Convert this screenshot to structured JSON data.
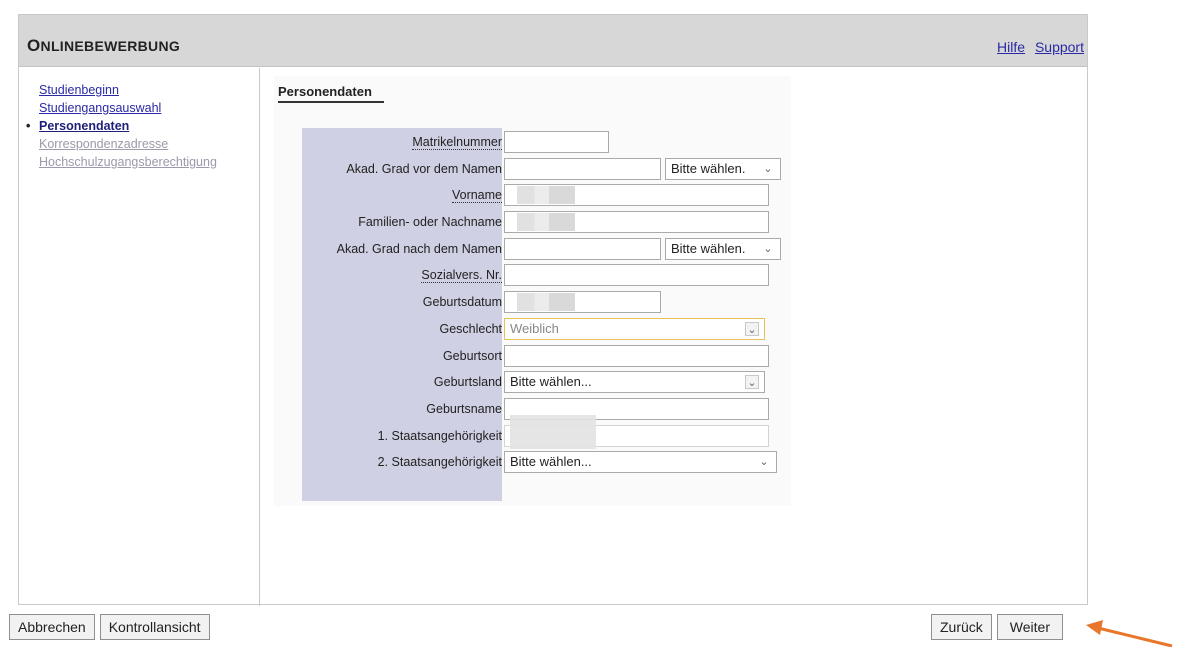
{
  "header": {
    "title_first": "O",
    "title_rest": "nlinebewerbung",
    "links": [
      "Hilfe",
      "Support"
    ]
  },
  "nav": {
    "items": [
      {
        "label": "Studienbeginn",
        "state": "done"
      },
      {
        "label": "Studiengangsauswahl",
        "state": "done"
      },
      {
        "label": "Personendaten",
        "state": "current",
        "bullet": "•"
      },
      {
        "label": "Korrespondenzadresse",
        "state": "disabled"
      },
      {
        "label": "Hochschulzugangsberechtigung",
        "state": "disabled"
      }
    ]
  },
  "form": {
    "tab": "Personendaten",
    "fields": {
      "matrikelnummer": {
        "label": "Matrikelnummer",
        "value": ""
      },
      "grad_vor": {
        "label": "Akad. Grad vor dem Namen",
        "value": "",
        "select": "Bitte wählen."
      },
      "vorname": {
        "label": "Vorname",
        "value": ""
      },
      "nachname": {
        "label": "Familien- oder Nachname",
        "value": ""
      },
      "grad_nach": {
        "label": "Akad. Grad nach dem Namen",
        "value": "",
        "select": "Bitte wählen."
      },
      "sozialvers": {
        "label": "Sozialvers. Nr.",
        "value": ""
      },
      "geburtsdatum": {
        "label": "Geburtsdatum",
        "value": ""
      },
      "geschlecht": {
        "label": "Geschlecht",
        "value": "Weiblich"
      },
      "geburtsort": {
        "label": "Geburtsort",
        "value": ""
      },
      "geburtsland": {
        "label": "Geburtsland",
        "value": "Bitte wählen..."
      },
      "geburtsname": {
        "label": "Geburtsname",
        "value": ""
      },
      "staat1": {
        "label": "1. Staatsangehörigkeit",
        "value": ""
      },
      "staat2": {
        "label": "2. Staatsangehörigkeit",
        "value": "Bitte wählen..."
      }
    }
  },
  "footer": {
    "left_buttons": [
      "Abbrechen",
      "Kontrollansicht"
    ],
    "right_buttons": [
      "Zurück",
      "Weiter"
    ]
  },
  "icons": {
    "dropdown": "chevron-down-icon",
    "pointer": "arrow-pointer-icon"
  },
  "colors": {
    "label_column": "#cfd0e3",
    "titlebar": "#d7d7d7",
    "link": "#2a2aa6",
    "highlight_border": "#e6c15a",
    "arrow": "#e8762b"
  }
}
